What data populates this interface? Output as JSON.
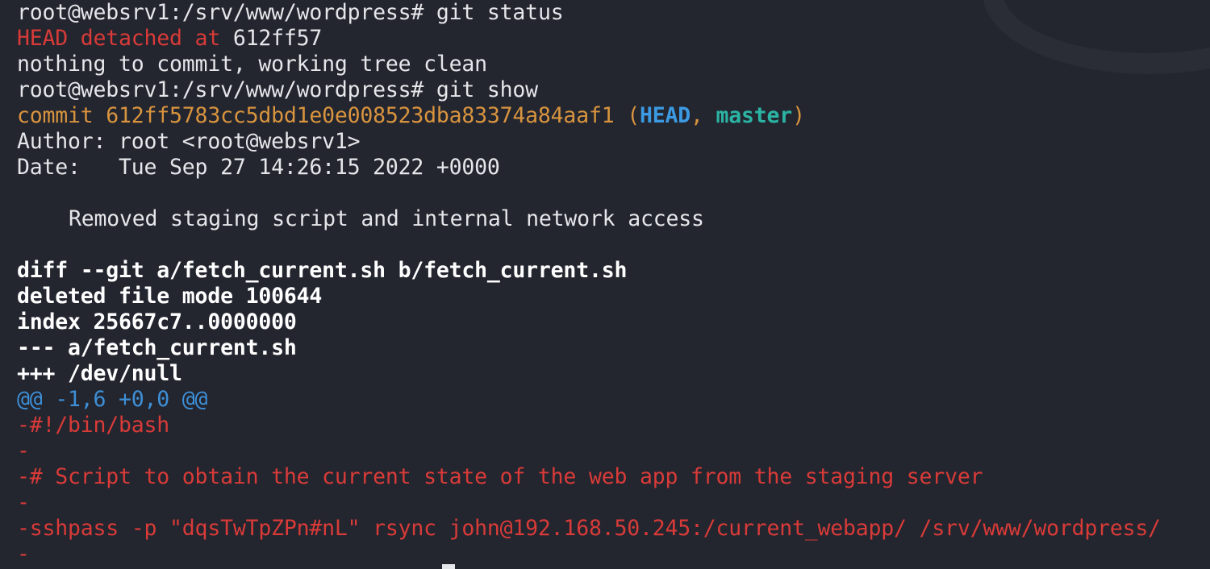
{
  "terminal": {
    "prompt": "root@websrv1:/srv/www/wordpress#",
    "cmd1": "git status",
    "head_detached_label": "HEAD detached at",
    "head_detached_hash": "612ff57",
    "clean_status": "nothing to commit, working tree clean",
    "cmd2": "git show",
    "commit_label": "commit 612ff5783cc5dbd1e0e008523dba83374a84aaf1",
    "ref_open": " (",
    "ref_head": "HEAD",
    "ref_sep": ", ",
    "ref_master": "master",
    "ref_close": ")",
    "author": "Author: root <root@websrv1>",
    "date": "Date:   Tue Sep 27 14:26:15 2022 +0000",
    "message": "Removed staging script and internal network access",
    "diff_header": "diff --git a/fetch_current.sh b/fetch_current.sh",
    "deleted_mode": "deleted file mode 100644",
    "index_line": "index 25667c7..0000000",
    "minus_file": "--- a/fetch_current.sh",
    "plus_file": "+++ /dev/null",
    "hunk_header": "@@ -1,6 +0,0 @@",
    "removed_lines": [
      "-#!/bin/bash",
      "-",
      "-# Script to obtain the current state of the web app from the staging server",
      "-",
      "-sshpass -p \"dqsTwTpZPn#nL\" rsync john@192.168.50.245:/current_webapp/ /srv/www/wordpress/",
      "-"
    ]
  },
  "colors": {
    "background": "#23252f",
    "foreground": "#e5e6e9",
    "red": "#d83b38",
    "commit_orange": "#d8943e",
    "head_blue": "#3b9ae2",
    "master_cyan": "#2bb3a3",
    "hunk_blue": "#3d8fd6"
  }
}
